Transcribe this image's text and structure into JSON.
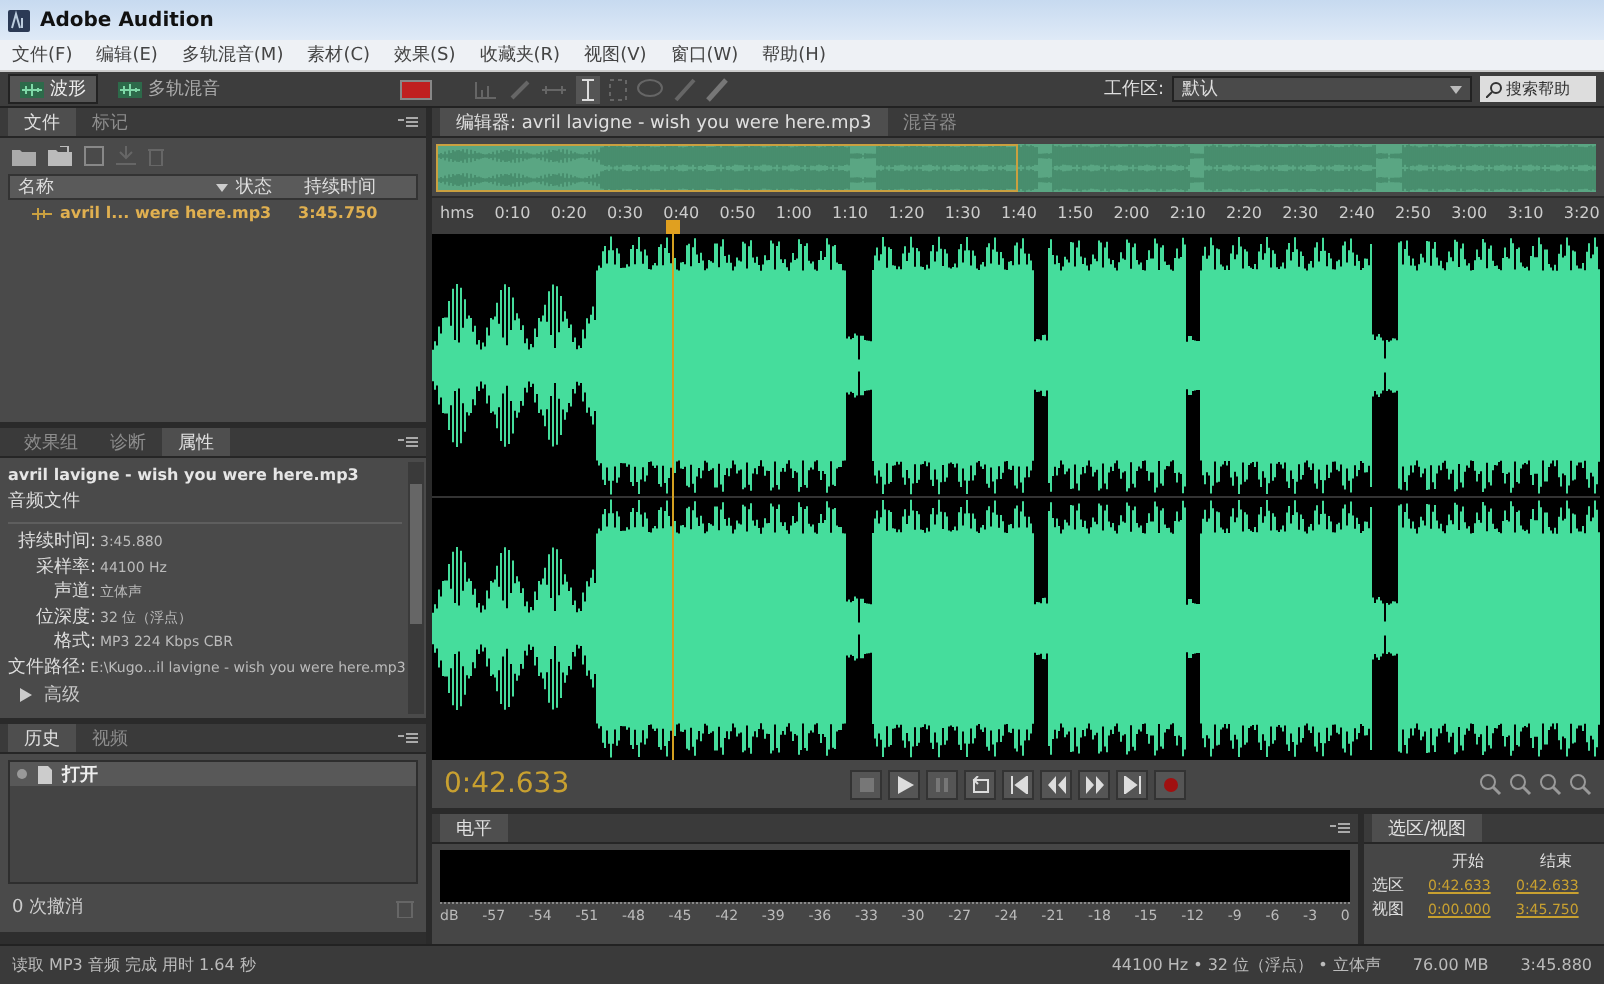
{
  "window": {
    "title": "Adobe Audition"
  },
  "menu": [
    "文件(F)",
    "编辑(E)",
    "多轨混音(M)",
    "素材(C)",
    "效果(S)",
    "收藏夹(R)",
    "视图(V)",
    "窗口(W)",
    "帮助(H)"
  ],
  "toolbar": {
    "modes": [
      {
        "label": "波形",
        "selected": true
      },
      {
        "label": "多轨混音",
        "selected": false
      }
    ],
    "workspace_label": "工作区:",
    "workspace": "默认",
    "search": {
      "placeholder": "搜索帮助"
    }
  },
  "files_panel": {
    "tabs": [
      {
        "label": "文件",
        "selected": true
      },
      {
        "label": "标记",
        "selected": false
      }
    ],
    "columns": [
      "名称",
      "状态",
      "持续时间"
    ],
    "rows": [
      {
        "name": "avril l... were here.mp3",
        "duration": "3:45.750"
      }
    ]
  },
  "properties_panel": {
    "tabs": [
      {
        "label": "效果组",
        "selected": false
      },
      {
        "label": "诊断",
        "selected": false
      },
      {
        "label": "属性",
        "selected": true
      }
    ],
    "file_name": "avril lavigne - wish you were here.mp3",
    "file_type": "音频文件",
    "fields": [
      {
        "label": "持续时间:",
        "value": "3:45.880"
      },
      {
        "label": "采样率:",
        "value": "44100 Hz"
      },
      {
        "label": "声道:",
        "value": "立体声"
      },
      {
        "label": "位深度:",
        "value": "32 位（浮点）"
      },
      {
        "label": "格式:",
        "value": "MP3 224 Kbps CBR"
      },
      {
        "label": "文件路径:",
        "value": "E:\\Kugo...il lavigne - wish you were here.mp3"
      }
    ],
    "advanced": {
      "label": "高级",
      "expanded": false
    }
  },
  "history_panel": {
    "tabs": [
      {
        "label": "历史",
        "selected": true
      },
      {
        "label": "视频",
        "selected": false
      }
    ],
    "items": [
      {
        "label": "打开",
        "selected": true
      }
    ],
    "undo_count": "0 次撤消"
  },
  "editor": {
    "tabs": [
      {
        "label": "编辑器: avril lavigne - wish you were here.mp3",
        "selected": true
      },
      {
        "label": "混音器",
        "selected": false
      }
    ],
    "ruler": [
      "hms",
      "0:10",
      "0:20",
      "0:30",
      "0:40",
      "0:50",
      "1:00",
      "1:10",
      "1:20",
      "1:30",
      "1:40",
      "1:50",
      "2:00",
      "2:10",
      "2:20",
      "2:30",
      "2:40",
      "2:50",
      "3:00",
      "3:10",
      "3:20"
    ],
    "playhead": {
      "level": 0.205
    },
    "time": "0:42.633"
  },
  "levels_panel": {
    "tab": "电平",
    "scale": [
      "dB",
      "-57",
      "-54",
      "-51",
      "-48",
      "-45",
      "-42",
      "-39",
      "-36",
      "-33",
      "-30",
      "-27",
      "-24",
      "-21",
      "-18",
      "-15",
      "-12",
      "-9",
      "-6",
      "-3",
      "0"
    ]
  },
  "selection_panel": {
    "title": "选区/视图",
    "columns": [
      "开始",
      "结束"
    ],
    "rows": [
      {
        "label": "选区",
        "start": "0:42.633",
        "end": "0:42.633"
      },
      {
        "label": "视图",
        "start": "0:00.000",
        "end": "3:45.750"
      }
    ]
  },
  "status_bar": {
    "message": "读取 MP3 音频 完成 用时 1.64 秒",
    "format": "44100 Hz • 32 位（浮点） • 立体声",
    "size": "76.00 MB",
    "duration": "3:45.880"
  }
}
